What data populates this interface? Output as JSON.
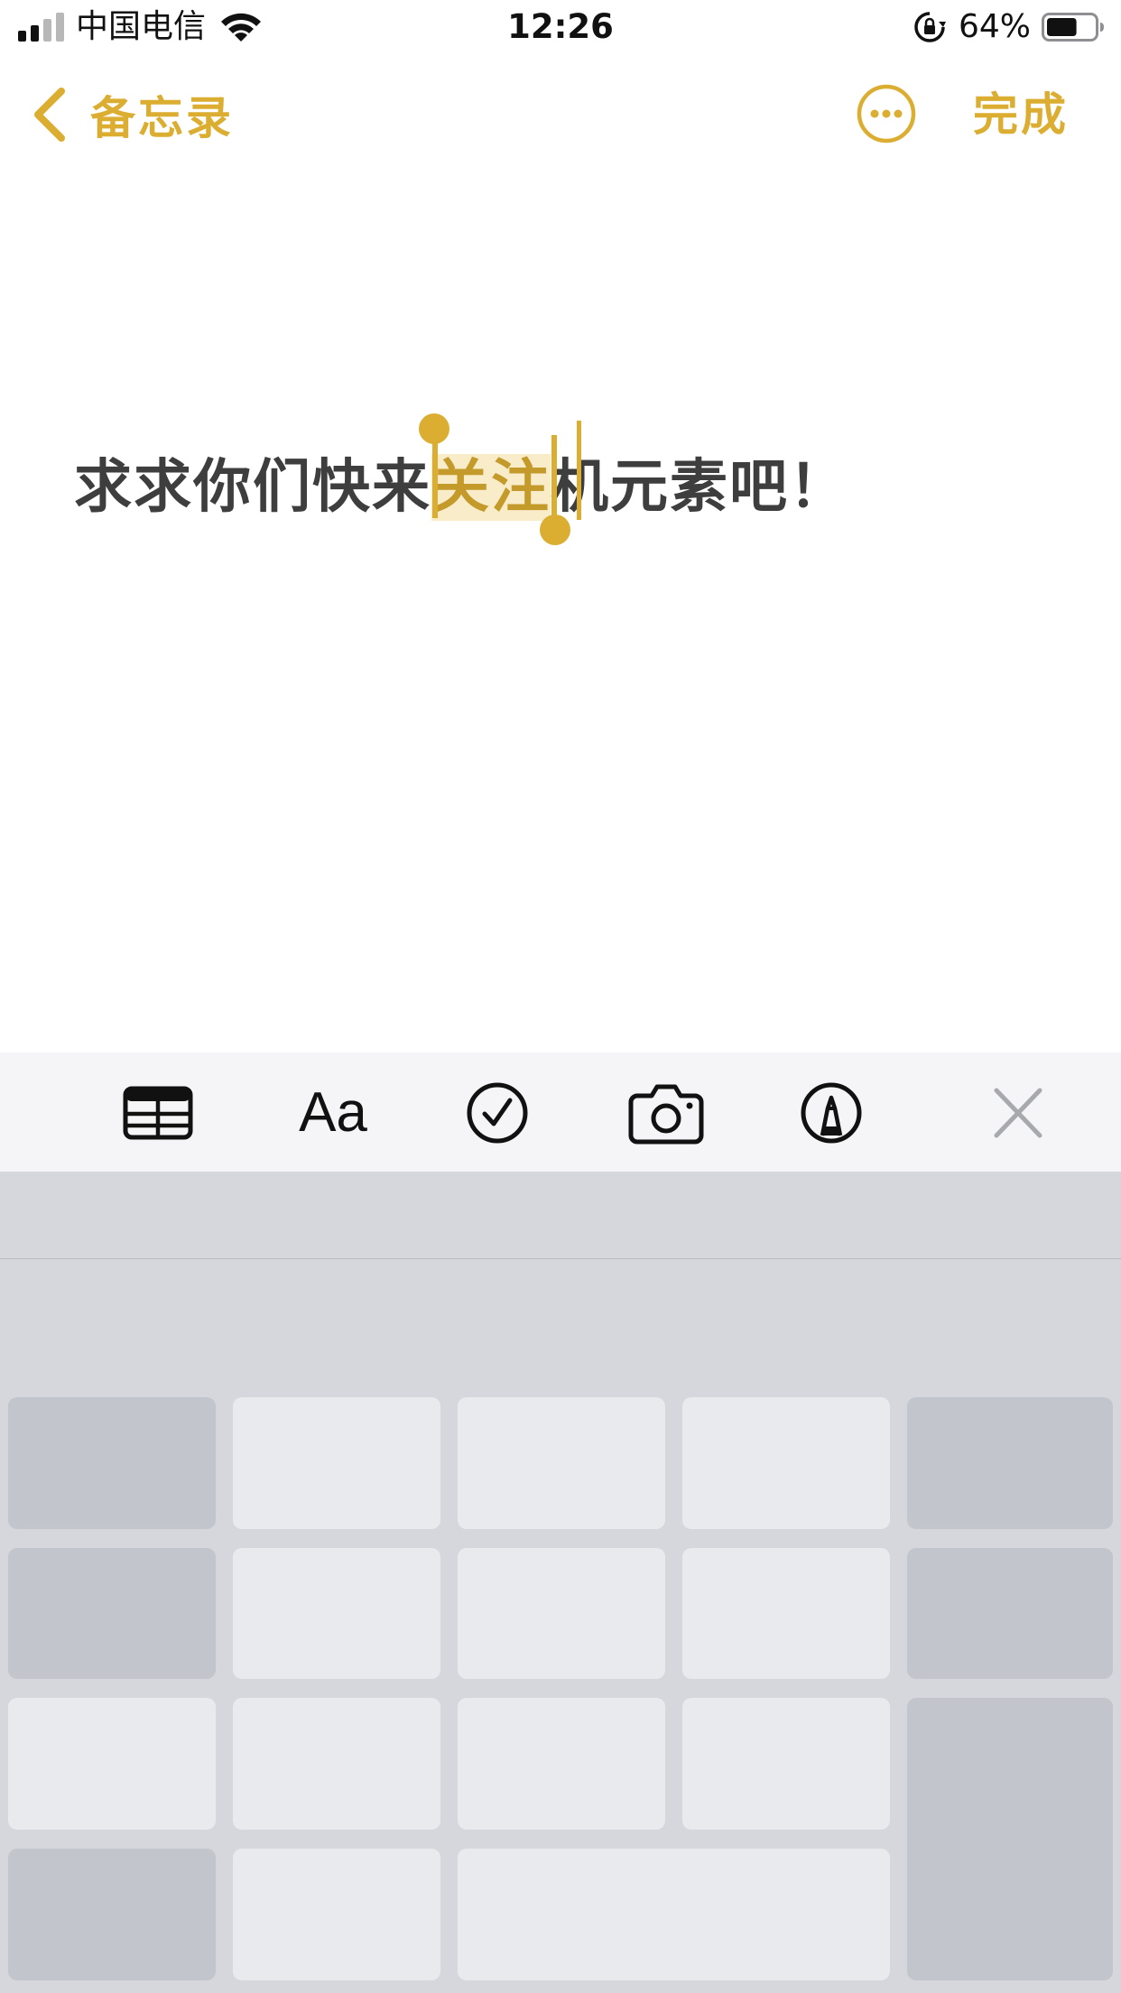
{
  "status_bar": {
    "carrier": "中国电信",
    "time": "12:26",
    "battery_percent": "64%",
    "battery_level": 0.64,
    "icons": [
      "signal-icon",
      "wifi-icon",
      "orientation-lock-icon",
      "battery-icon"
    ]
  },
  "nav": {
    "back_label": "备忘录",
    "done_label": "完成",
    "accent_color": "#dbae32"
  },
  "note": {
    "text_before": "求求你们快来",
    "text_selected": "关注",
    "text_after": "机元素吧！"
  },
  "toolbar": {
    "items": [
      "table-icon",
      "format-icon",
      "checklist-icon",
      "camera-icon",
      "markup-icon",
      "close-icon"
    ],
    "format_label": "Aa"
  },
  "keyboard": {
    "rows": 4,
    "columns": 5
  }
}
